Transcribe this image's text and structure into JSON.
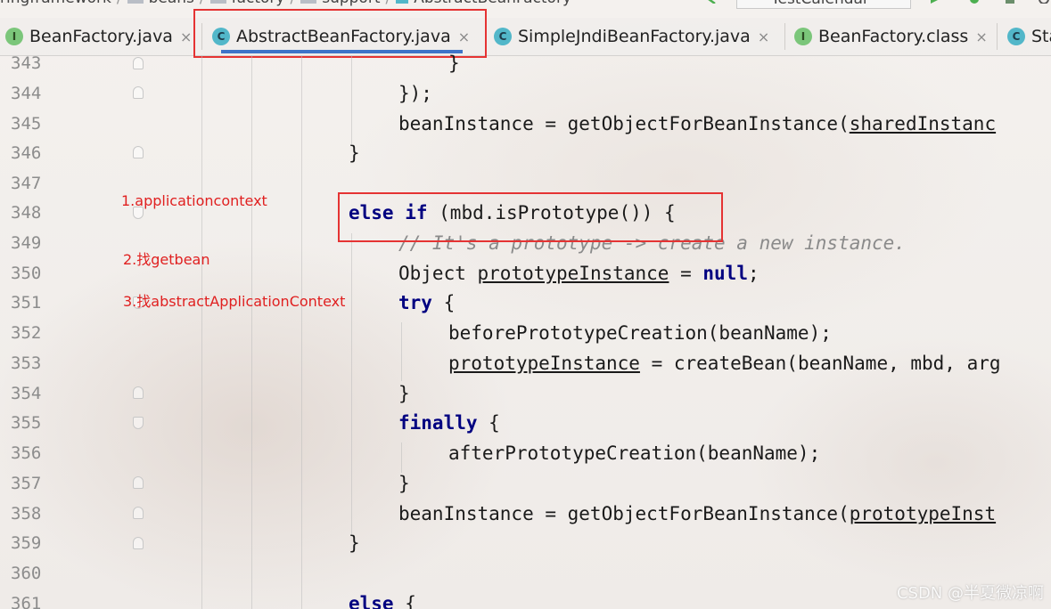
{
  "breadcrumb": {
    "items": [
      "ringframework",
      "beans",
      "factory",
      "support",
      "AbstractBeanFactory"
    ]
  },
  "run_config": {
    "label": "TestCalendar"
  },
  "tabs": [
    {
      "label": "BeanFactory.java",
      "kind": "interface",
      "badge": "I",
      "active": false
    },
    {
      "label": "AbstractBeanFactory.java",
      "kind": "class",
      "badge": "C",
      "active": true
    },
    {
      "label": "SimpleJndiBeanFactory.java",
      "kind": "class",
      "badge": "C",
      "active": false
    },
    {
      "label": "BeanFactory.class",
      "kind": "interface",
      "badge": "I",
      "active": false
    },
    {
      "label": "Sta",
      "kind": "class",
      "badge": "C",
      "active": false
    }
  ],
  "tab_close_glyph": "×",
  "line_numbers": [
    "343",
    "344",
    "345",
    "346",
    "347",
    "348",
    "349",
    "350",
    "351",
    "352",
    "353",
    "354",
    "355",
    "356",
    "357",
    "358",
    "359",
    "360",
    "361"
  ],
  "code": {
    "l343": "}",
    "l344": "});",
    "l345_a": "beanInstance = getObjectForBeanInstance(",
    "l345_b": "sharedInstanc",
    "l346": "}",
    "l348_kw1": "else if",
    "l348_rest": " (mbd.isPrototype()) {",
    "l349": "// It's a prototype -> create a new instance.",
    "l350_a": "Object ",
    "l350_b": "prototypeInstance",
    "l350_c": " = ",
    "l350_kw": "null",
    "l350_d": ";",
    "l351_kw": "try",
    "l351_rest": " {",
    "l352": "beforePrototypeCreation(beanName);",
    "l353_a": "prototypeInstance",
    "l353_b": " = createBean(beanName, mbd, arg",
    "l354": "}",
    "l355_kw": "finally",
    "l355_rest": " {",
    "l356": "afterPrototypeCreation(beanName);",
    "l357": "}",
    "l358_a": "beanInstance = getObjectForBeanInstance(",
    "l358_b": "prototypeInst",
    "l359": "}",
    "l361_kw": "else",
    "l361_rest": " {"
  },
  "annotations": [
    "1.applicationcontext",
    "2.找getbean",
    "3.找abstractApplicationContext"
  ],
  "watermark": "CSDN @半夏微凉啊",
  "colors": {
    "keyword": "#000080",
    "comment": "#8a8a8a",
    "annotation": "#e02020",
    "highlight_box": "#e53333",
    "active_tab_underline": "#3f74c8"
  }
}
